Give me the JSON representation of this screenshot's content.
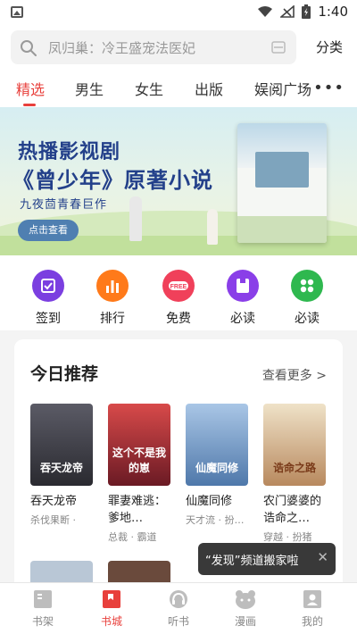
{
  "status_bar": {
    "time": "1:40"
  },
  "search": {
    "placeholder": "凤归巢：冷王盛宠法医妃",
    "category_label": "分类"
  },
  "tabs": [
    {
      "label": "精选",
      "active": true
    },
    {
      "label": "男生"
    },
    {
      "label": "女生"
    },
    {
      "label": "出版"
    },
    {
      "label": "娱阅广场"
    }
  ],
  "banner": {
    "title_line1": "热播影视剧",
    "title_line2": "《曾少年》原著小说",
    "subtitle": "九夜茴青春巨作",
    "button_label": "点击查看"
  },
  "quick_actions": [
    {
      "label": "签到",
      "icon": "check-icon",
      "color": "#7b3fe0"
    },
    {
      "label": "排行",
      "icon": "bar-chart-icon",
      "color": "#ff7a1a"
    },
    {
      "label": "免费",
      "icon": "free-icon",
      "color": "#f0405a"
    },
    {
      "label": "必读",
      "icon": "bookmark-icon",
      "color": "#8a3fe8"
    },
    {
      "label": "必读",
      "icon": "grid-icon",
      "color": "#2fb84f"
    }
  ],
  "recommend": {
    "title": "今日推荐",
    "see_more": "查看更多 >",
    "books": [
      {
        "title": "吞天龙帝",
        "meta": "杀伐果断 ·",
        "cover_text": "吞天龙帝",
        "cover_color": "#3c3c44"
      },
      {
        "title": "罪妻难逃：爹地…",
        "meta": "总裁 · 霸道",
        "cover_text": "这个不是我的崽",
        "cover_color": "#8a2430"
      },
      {
        "title": "仙魔同修",
        "meta": "天才流 · 扮…",
        "cover_text": "仙魔同修",
        "cover_color": "#6e98c8"
      },
      {
        "title": "农门婆婆的诰命之…",
        "meta": "穿越 · 扮猪",
        "cover_text": "诰命之路",
        "cover_color": "#c7a77e"
      }
    ]
  },
  "toast": {
    "text": "“发现”频道搬家啦",
    "close": "✕"
  },
  "bottom_nav": [
    {
      "label": "书架",
      "icon": "bookshelf-icon"
    },
    {
      "label": "书城",
      "icon": "bookstore-icon",
      "active": true
    },
    {
      "label": "听书",
      "icon": "headphones-icon"
    },
    {
      "label": "漫画",
      "icon": "comic-icon"
    },
    {
      "label": "我的",
      "icon": "profile-icon"
    }
  ],
  "colors": {
    "accent": "#e8403c",
    "banner_text": "#23408a"
  }
}
